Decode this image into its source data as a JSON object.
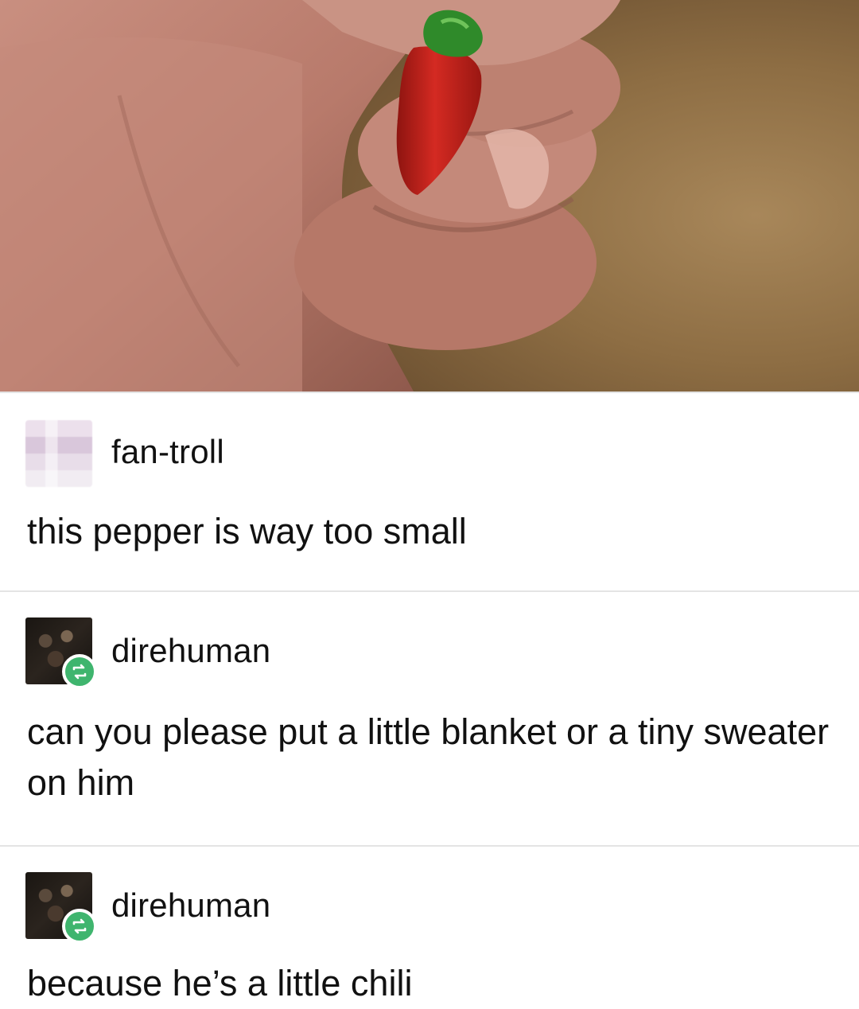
{
  "photo": {
    "description_icon": "hand-holding-tiny-chili-pepper"
  },
  "posts": [
    {
      "username": "fan-troll",
      "text": "this pepper is way too small",
      "avatar": "blurred-avatar",
      "reblogged": false
    },
    {
      "username": "direhuman",
      "text": "can you please put a little blanket or a tiny sweater on him",
      "avatar": "dark-avatar",
      "reblogged": true
    },
    {
      "username": "direhuman",
      "text": "because he’s a little chili",
      "avatar": "dark-avatar",
      "reblogged": true
    }
  ],
  "colors": {
    "reblog_badge": "#3fb56e",
    "divider": "#e4e4e4",
    "pepper": "#c4201c"
  }
}
